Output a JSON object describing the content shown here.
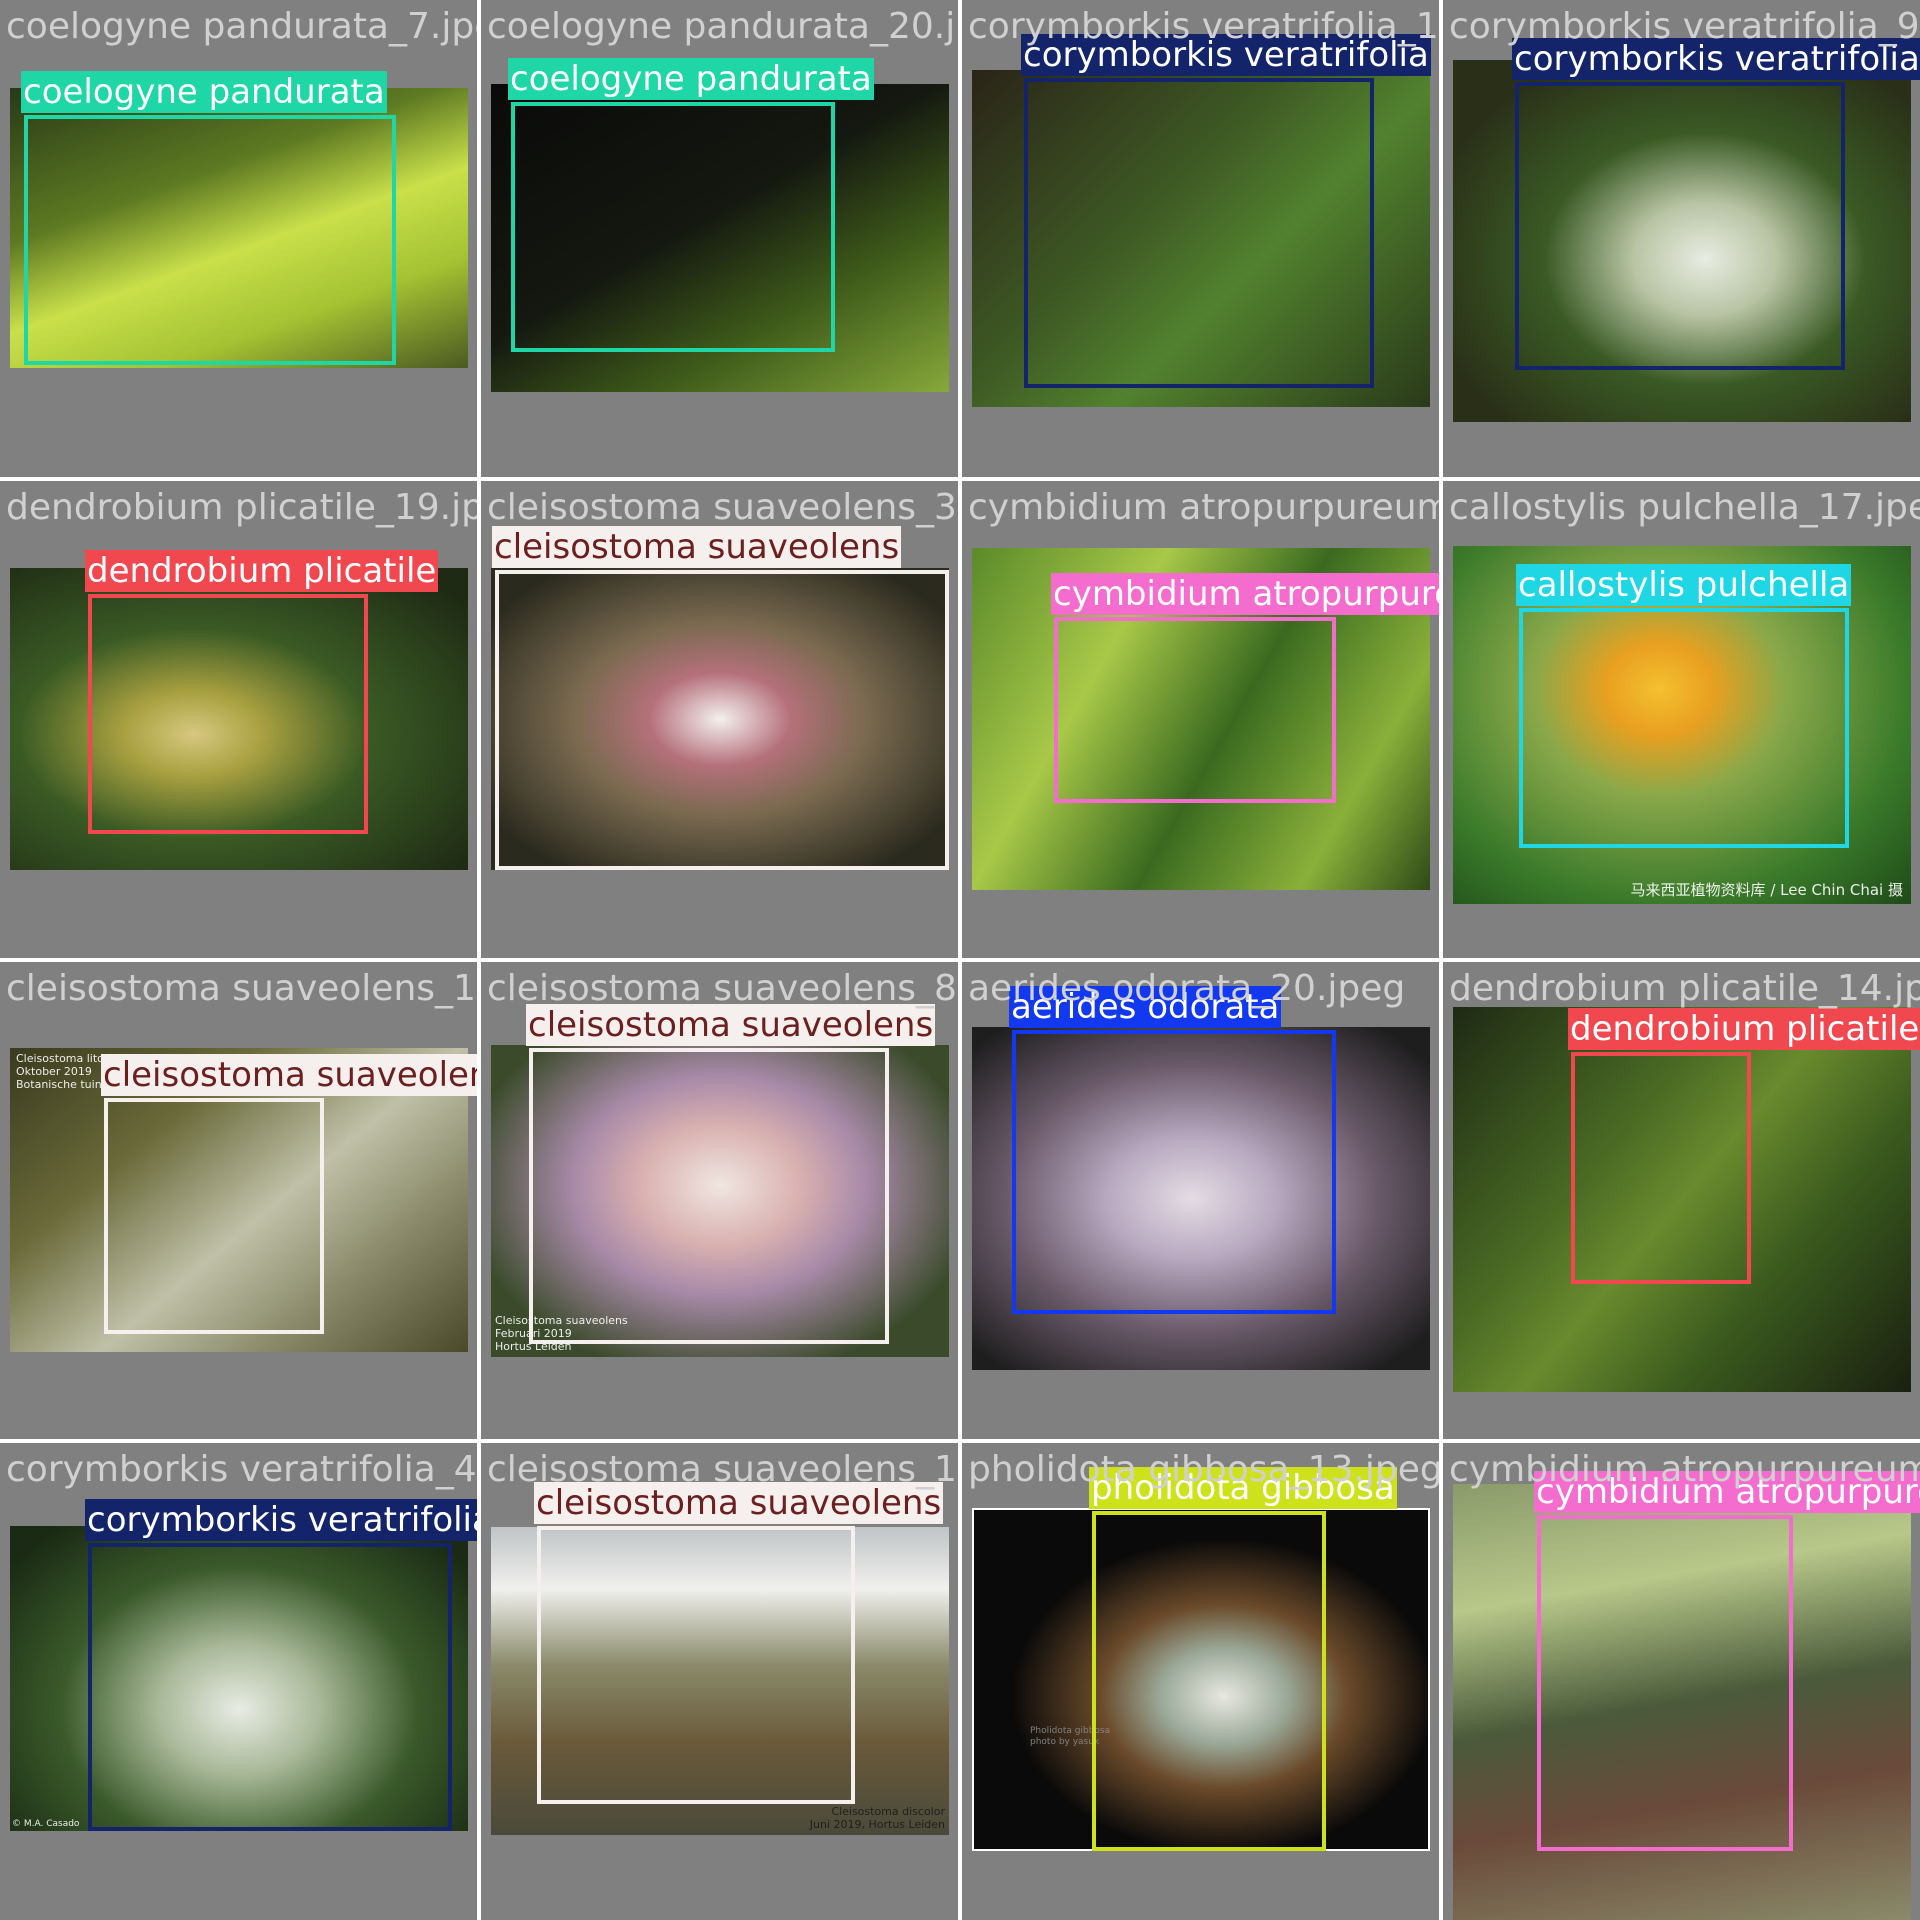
{
  "tiles": [
    {
      "file": "coelogyne pandurata_7.jpeg",
      "label": "coelogyne pandurata",
      "box_color": "#1fd6a6",
      "text_color": "#ffffff"
    },
    {
      "file": "coelogyne pandurata_20.jpeg",
      "label": "coelogyne pandurata",
      "box_color": "#1fd6a6",
      "text_color": "#ffffff"
    },
    {
      "file": "corymborkis veratrifolia_15.jpeg",
      "label": "corymborkis veratrifolia",
      "box_color": "#14246a",
      "text_color": "#ffffff"
    },
    {
      "file": "corymborkis veratrifolia_9.jpeg",
      "label": "corymborkis veratrifolia",
      "box_color": "#14246a",
      "text_color": "#ffffff"
    },
    {
      "file": "dendrobium plicatile_19.jpeg",
      "label": "dendrobium plicatile",
      "box_color": "#f14850",
      "text_color": "#ffffff"
    },
    {
      "file": "cleisostoma suaveolens_3.jpeg",
      "label": "cleisostoma suaveolens",
      "box_color": "#f5f0ee",
      "text_color": "#6b1f1f"
    },
    {
      "file": "cymbidium atropurpureum_2.jpeg",
      "label": "cymbidium atropurpureum",
      "box_color": "#f56ccf",
      "text_color": "#ffffff"
    },
    {
      "file": "callostylis pulchella_17.jpeg",
      "label": "callostylis pulchella",
      "box_color": "#1fd7e4",
      "text_color": "#ffffff",
      "credit": "马来西亚植物资料库 / Lee Chin Chai 摄"
    },
    {
      "file": "cleisostoma suaveolens_16.jpeg",
      "label": "cleisostoma suaveolens",
      "box_color": "#f5f0ee",
      "text_color": "#6b1f1f",
      "credit": "Cleisostoma litoreum\nOktober 2019\nBotanische tuin U"
    },
    {
      "file": "cleisostoma suaveolens_8.jpeg",
      "label": "cleisostoma suaveolens",
      "box_color": "#f5f0ee",
      "text_color": "#6b1f1f",
      "credit": "Cleisostoma suaveolens\nFebruari 2019\nHortus Leiden"
    },
    {
      "file": "aerides odorata_20.jpeg",
      "label": "aerides odorata",
      "box_color": "#1238f0",
      "text_color": "#ffffff"
    },
    {
      "file": "dendrobium plicatile_14.jpeg",
      "label": "dendrobium plicatile",
      "box_color": "#f14850",
      "text_color": "#ffffff"
    },
    {
      "file": "corymborkis veratrifolia_4.jpeg",
      "label": "corymborkis veratrifolia",
      "box_color": "#14246a",
      "text_color": "#ffffff",
      "credit": "© M.A. Casado"
    },
    {
      "file": "cleisostoma suaveolens_19.jpeg",
      "label": "cleisostoma suaveolens",
      "box_color": "#f5f0ee",
      "text_color": "#6b1f1f",
      "credit": "Cleisostoma discolor\nJuni 2019, Hortus Leiden"
    },
    {
      "file": "pholidota gibbosa_13.jpeg",
      "label": "pholidota gibbosa",
      "box_color": "#cde21a",
      "text_color": "#ffffff",
      "credit": "Pholidota gibbosa\nphoto by yasuk"
    },
    {
      "file": "cymbidium atropurpureum_4.jpeg",
      "label": "cymbidium atropurpureum",
      "box_color": "#f56ccf",
      "text_color": "#ffffff"
    }
  ]
}
